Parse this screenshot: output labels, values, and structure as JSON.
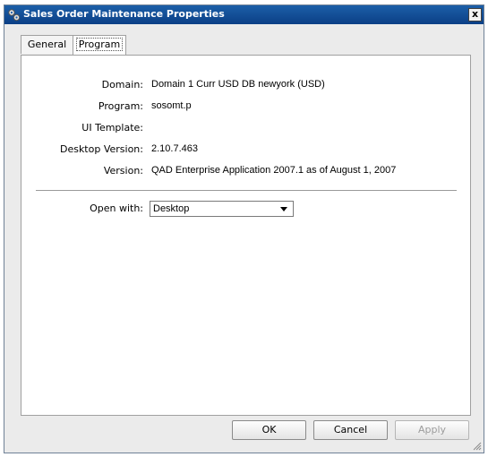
{
  "window": {
    "title": "Sales Order Maintenance Properties",
    "close_label": "x"
  },
  "tabs": [
    {
      "label": "General"
    },
    {
      "label": "Program"
    }
  ],
  "fields": {
    "domain_label": "Domain:",
    "domain_value": "Domain 1 Curr USD DB newyork (USD)",
    "program_label": "Program:",
    "program_value": "sosomt.p",
    "ui_template_label": "UI Template:",
    "ui_template_value": "",
    "desktop_version_label": "Desktop Version:",
    "desktop_version_value": "2.10.7.463",
    "version_label": "Version:",
    "version_value": "QAD Enterprise Application 2007.1 as of August 1, 2007",
    "open_with_label": "Open with:",
    "open_with_value": "Desktop"
  },
  "buttons": {
    "ok": "OK",
    "cancel": "Cancel",
    "apply": "Apply"
  },
  "icons": {
    "title_icon": "gears-icon",
    "dropdown": "chevron-down-icon",
    "resize": "resize-grip-icon"
  }
}
